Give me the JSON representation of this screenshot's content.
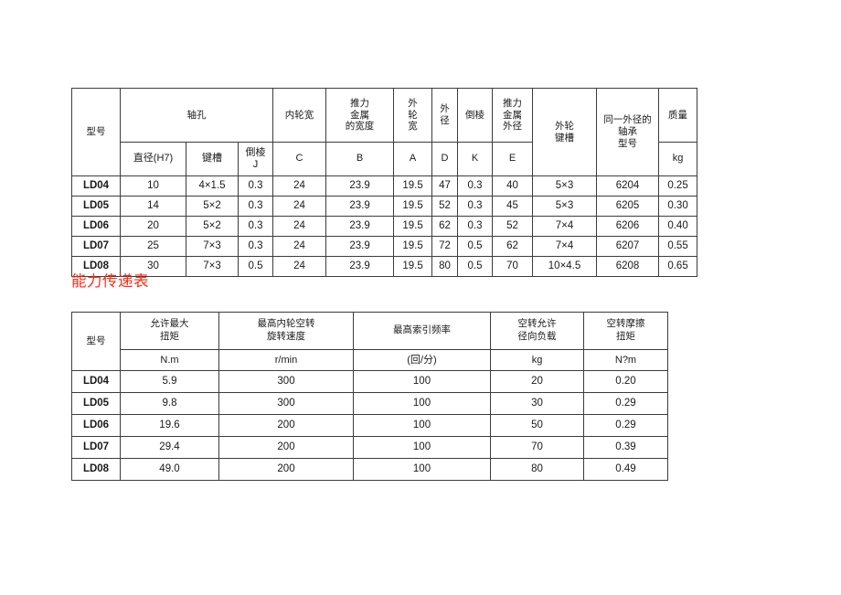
{
  "document": {
    "section_heading": "能力传递表"
  },
  "spec_table": {
    "header_groups": {
      "model": "型号",
      "shaft_hole": "轴孔",
      "inner_wheel_width": "内轮宽",
      "thrust_metal_width": [
        "推力",
        "金属",
        "的宽度"
      ],
      "outer_wheel_width": [
        "外",
        "轮",
        "宽"
      ],
      "outer_diameter": [
        "外",
        "径"
      ],
      "chamfer": "倒棱",
      "thrust_metal_outer_diameter": [
        "推力",
        "金属",
        "外径"
      ],
      "outer_wheel_keyway": [
        "外轮",
        "键槽"
      ],
      "same_outer_diameter_bearing_model": [
        "同一外径的",
        "轴承",
        "型号"
      ],
      "mass": "质量"
    },
    "sub_headers": {
      "diameter_h7": "直径(H7)",
      "keyway": "键槽",
      "chamfer_j": [
        "倒棱",
        "J"
      ],
      "c": "C",
      "b": "B",
      "a": "A",
      "d": "D",
      "k": "K",
      "e": "E",
      "mass_unit": "kg"
    },
    "rows": [
      {
        "model": "LD04",
        "diameter": "10",
        "keyway": "4×1.5",
        "chamfer_j": "0.3",
        "c": "24",
        "b": "23.9",
        "a": "19.5",
        "d": "47",
        "k": "0.3",
        "e": "40",
        "outer_keyway": "5×3",
        "bearing_model": "6204",
        "mass": "0.25"
      },
      {
        "model": "LD05",
        "diameter": "14",
        "keyway": "5×2",
        "chamfer_j": "0.3",
        "c": "24",
        "b": "23.9",
        "a": "19.5",
        "d": "52",
        "k": "0.3",
        "e": "45",
        "outer_keyway": "5×3",
        "bearing_model": "6205",
        "mass": "0.30"
      },
      {
        "model": "LD06",
        "diameter": "20",
        "keyway": "5×2",
        "chamfer_j": "0.3",
        "c": "24",
        "b": "23.9",
        "a": "19.5",
        "d": "62",
        "k": "0.3",
        "e": "52",
        "outer_keyway": "7×4",
        "bearing_model": "6206",
        "mass": "0.40"
      },
      {
        "model": "LD07",
        "diameter": "25",
        "keyway": "7×3",
        "chamfer_j": "0.3",
        "c": "24",
        "b": "23.9",
        "a": "19.5",
        "d": "72",
        "k": "0.5",
        "e": "62",
        "outer_keyway": "7×4",
        "bearing_model": "6207",
        "mass": "0.55"
      },
      {
        "model": "LD08",
        "diameter": "30",
        "keyway": "7×3",
        "chamfer_j": "0.5",
        "c": "24",
        "b": "23.9",
        "a": "19.5",
        "d": "80",
        "k": "0.5",
        "e": "70",
        "outer_keyway": "10×4.5",
        "bearing_model": "6208",
        "mass": "0.65"
      }
    ]
  },
  "capacity_table": {
    "headers": {
      "model": "型号",
      "max_torque": [
        "允许最大",
        "扭矩"
      ],
      "max_inner_wheel_idle_speed": [
        "最高内轮空转",
        "旋转速度"
      ],
      "max_index_frequency": "最高索引频率",
      "idle_allowed_radial_load": [
        "空转允许",
        "径向负载"
      ],
      "idle_friction_torque": [
        "空转摩擦",
        "扭矩"
      ]
    },
    "units": {
      "max_torque": "N.m",
      "speed": "r/min",
      "frequency": "(回/分)",
      "radial_load": "kg",
      "friction_torque": "N?m"
    },
    "rows": [
      {
        "model": "LD04",
        "torque": "5.9",
        "speed": "300",
        "frequency": "100",
        "radial_load": "20",
        "friction_torque": "0.20"
      },
      {
        "model": "LD05",
        "torque": "9.8",
        "speed": "300",
        "frequency": "100",
        "radial_load": "30",
        "friction_torque": "0.29"
      },
      {
        "model": "LD06",
        "torque": "19.6",
        "speed": "200",
        "frequency": "100",
        "radial_load": "50",
        "friction_torque": "0.29"
      },
      {
        "model": "LD07",
        "torque": "29.4",
        "speed": "200",
        "frequency": "100",
        "radial_load": "70",
        "friction_torque": "0.39"
      },
      {
        "model": "LD08",
        "torque": "49.0",
        "speed": "200",
        "frequency": "100",
        "radial_load": "80",
        "friction_torque": "0.49"
      }
    ]
  }
}
